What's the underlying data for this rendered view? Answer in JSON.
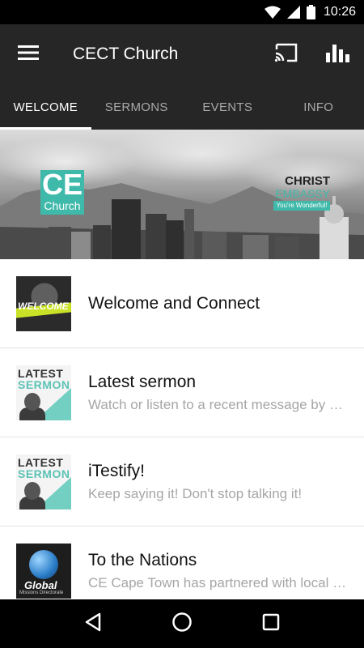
{
  "status_bar": {
    "time": "10:26",
    "icons": [
      "wifi-icon",
      "cell-signal-icon",
      "battery-icon"
    ]
  },
  "app_bar": {
    "title": "CECT Church",
    "actions": [
      "cast-icon",
      "bar-chart-icon"
    ]
  },
  "tabs": [
    {
      "label": "WELCOME",
      "active": true
    },
    {
      "label": "SERMONS",
      "active": false
    },
    {
      "label": "EVENTS",
      "active": false
    },
    {
      "label": "INFO",
      "active": false
    }
  ],
  "banner": {
    "logo_ce": "CE",
    "logo_church": "Church",
    "embassy_line1": "CHRIST",
    "embassy_line2": "EMBASSY",
    "embassy_tagline": "You're Wonderful!"
  },
  "list": [
    {
      "title": "Welcome and Connect",
      "subtitle": "",
      "thumb_text": "WELCOME"
    },
    {
      "title": "Latest sermon",
      "subtitle": "Watch or listen to a recent message by our pastor",
      "thumb_line1": "LATEST",
      "thumb_line2": "SERMON"
    },
    {
      "title": "iTestify!",
      "subtitle": "Keep saying it! Don't stop talking it!",
      "thumb_line1": "LATEST",
      "thumb_line2": "SERMON"
    },
    {
      "title": "To the Nations",
      "subtitle": "CE Cape Town has partnered with local ministries",
      "thumb_word": "Global",
      "thumb_sub": "Missions Directorate"
    }
  ],
  "colors": {
    "app_bar": "#262626",
    "accent": "#3fb9a9",
    "status_bar": "#000000"
  }
}
